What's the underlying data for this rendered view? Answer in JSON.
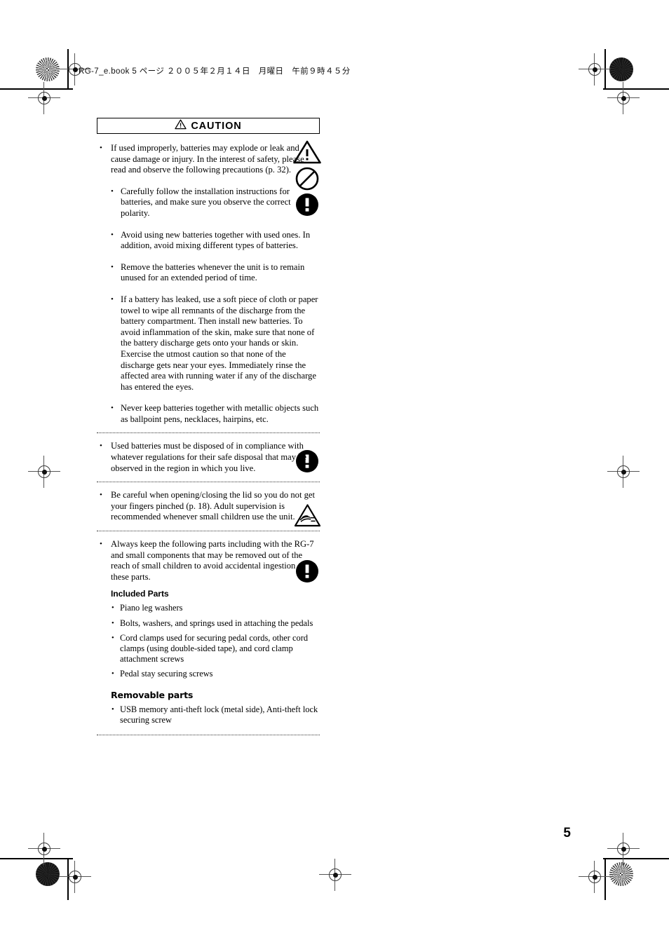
{
  "header": {
    "slug": "RG-7_e.book  5 ページ  ２００５年２月１４日　月曜日　午前９時４５分"
  },
  "caution": {
    "label": "CAUTION",
    "icon": "warning-triangle-icon"
  },
  "page_number": "5",
  "icons": {
    "warning_triangle": "warning-triangle-icon",
    "prohibition": "prohibition-circle-icon",
    "mandatory": "mandatory-exclamation-icon",
    "pinch_hand": "pinch-hazard-triangle-icon"
  },
  "sections": [
    {
      "id": "batteries",
      "primary": "If used improperly, batteries may explode or leak and cause damage or injury. In the interest of safety, please read and observe the following precautions (p. 32).",
      "sub_items": [
        "Carefully follow the installation instructions for batteries, and make sure you observe the correct polarity.",
        "Avoid using new batteries together with used ones. In addition, avoid mixing different types of batteries.",
        "Remove the batteries whenever the unit is to remain unused for an extended period of time.",
        "If a battery has leaked, use a soft piece of cloth or paper towel to wipe all remnants of the discharge from the battery compartment. Then install new batteries. To avoid inflammation of the skin, make sure that none of the battery discharge gets onto your hands or skin. Exercise the utmost caution so that none of the discharge gets near your eyes. Immediately rinse the affected area with running water if any of the discharge has entered the eyes.",
        "Never keep batteries together with metallic objects such as ballpoint pens, necklaces, hairpins, etc."
      ]
    },
    {
      "id": "disposal",
      "primary": "Used batteries must be disposed of in compliance with whatever regulations for their safe disposal that may be observed in the region in which you live."
    },
    {
      "id": "lid-pinch",
      "primary": "Be careful when opening/closing the lid so you do not get your fingers pinched (p. 18). Adult supervision is recommended whenever small children use the unit."
    },
    {
      "id": "small-parts",
      "primary": "Always keep the following parts including with the RG-7 and small components that may be removed out of the reach of small children to avoid accidental ingestion of these parts.",
      "included_heading": "Included Parts",
      "included_parts": [
        "Piano leg washers",
        "Bolts, washers, and springs used in attaching the pedals",
        "Cord clamps used for securing pedal cords, other cord clamps (using double-sided tape), and cord clamp attachment screws",
        "Pedal stay securing screws"
      ],
      "removable_heading": "Removable parts",
      "removable_parts": [
        "USB memory anti-theft lock (metal side), Anti-theft lock securing screw"
      ]
    }
  ]
}
